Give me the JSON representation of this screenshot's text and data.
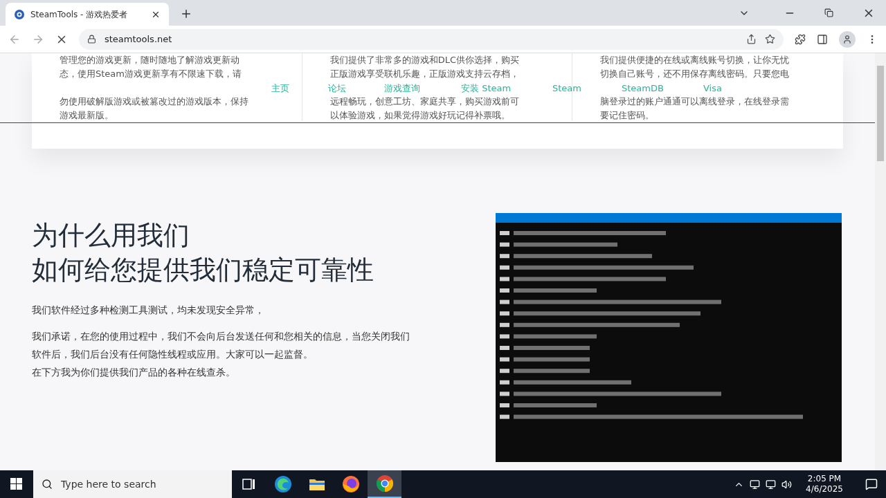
{
  "browser": {
    "tab": {
      "title": "SteamTools - 游戏热爱者",
      "selected": true
    },
    "url": "steamtools.net"
  },
  "nav": {
    "links": [
      {
        "label": "主页"
      },
      {
        "label": "论坛"
      },
      {
        "label": "游戏查询"
      },
      {
        "label": "安装 Steam"
      },
      {
        "label": "Steam"
      },
      {
        "label": "SteamDB"
      },
      {
        "label": "Visa"
      }
    ]
  },
  "features": [
    {
      "lines": [
        "管理您的游戏更新，随时随地了解游戏更新动",
        "态，使用Steam游戏更新享有不限速下载，请",
        "勿使用破解版游戏或被篡改过的游戏版本，保持",
        "游戏最新版。"
      ]
    },
    {
      "lines": [
        "我们提供了非常多的游戏和DLC供你选择，购买",
        "正版游戏享受联机乐趣，正版游戏支持云存档，",
        "远程畅玩，创意工坊、家庭共享，购买游戏前可",
        "以体验游戏，如果觉得游戏好玩记得补票哦。"
      ]
    },
    {
      "lines": [
        "我们提供便捷的在线或离线账号切换，让你无忧",
        "切换自己账号，还不用保存离线密码。只要您电",
        "脑登录过的账户通通可以离线登录，在线登录需",
        "要记住密码。"
      ]
    }
  ],
  "why": {
    "title_lines": [
      "为什么用我们",
      "如何给您提供我们稳定可靠性"
    ],
    "paragraphs": [
      "我们软件经过多种检测工具测试，均未发现安全异常，",
      "我们承诺，在您的使用过程中，我们不会向后台发送任何和您相关的信息，当您关闭我们软件后，我们后台没有任何隐性线程或应用。大家可以一起监督。",
      "在下方我为你们提供我们产品的各种在线查杀。"
    ]
  },
  "taskbar": {
    "search_placeholder": "Type here to search",
    "apps": [
      {
        "kind": "taskview",
        "active": false
      },
      {
        "kind": "edge",
        "active": false
      },
      {
        "kind": "explorer",
        "active": false
      },
      {
        "kind": "firefox",
        "active": false
      },
      {
        "kind": "chrome",
        "active": true
      }
    ],
    "time": "2:05 PM",
    "date": "4/6/2025"
  }
}
